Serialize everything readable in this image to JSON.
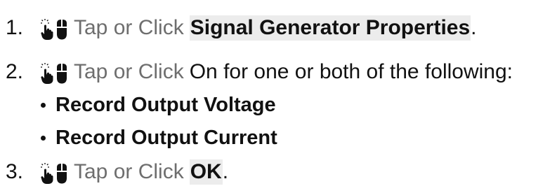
{
  "steps": [
    {
      "number": "1.",
      "icon_names": [
        "tap-hand-icon",
        "mouse-click-icon"
      ],
      "action": "Tap or Click",
      "target": "Signal Generator Properties",
      "suffix": "."
    },
    {
      "number": "2.",
      "icon_names": [
        "tap-hand-icon",
        "mouse-click-icon"
      ],
      "action": "Tap or Click",
      "text": "On for one or both of the following:",
      "options": [
        "Record Output Voltage",
        "Record Output Current"
      ]
    },
    {
      "number": "3.",
      "icon_names": [
        "tap-hand-icon",
        "mouse-click-icon"
      ],
      "action": "Tap or Click",
      "target": "OK",
      "suffix": "."
    }
  ],
  "colors": {
    "action_text": "#6e6e6e",
    "highlight_bg": "#ececec",
    "body_text": "#111111"
  }
}
